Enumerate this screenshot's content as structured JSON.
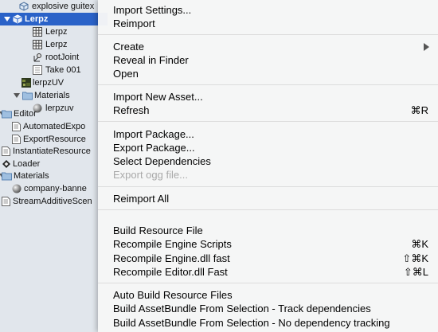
{
  "tree": {
    "items": [
      {
        "label": "explosive guitex",
        "icon": "package-icon"
      },
      {
        "label": "Lerpz",
        "icon": "package-icon"
      },
      {
        "label": "Lerpz",
        "icon": "grid-mesh-icon"
      },
      {
        "label": "Lerpz",
        "icon": "grid-mesh-icon"
      },
      {
        "label": "rootJoint",
        "icon": "transform-icon"
      },
      {
        "label": "Take 001",
        "icon": "animation-clip-icon"
      },
      {
        "label": "lerpzUV",
        "icon": "texture-thumbnail-icon"
      },
      {
        "label": "Materials",
        "icon": "folder-icon"
      },
      {
        "label": "lerpzuv",
        "icon": "material-sphere-icon"
      },
      {
        "label": "Editor",
        "icon": "folder-icon"
      },
      {
        "label": "AutomatedExpo",
        "icon": "script-icon"
      },
      {
        "label": "ExportResource",
        "icon": "script-icon"
      },
      {
        "label": "InstantiateResource",
        "icon": "script-icon"
      },
      {
        "label": "Loader",
        "icon": "unity-scene-icon"
      },
      {
        "label": "Materials",
        "icon": "folder-icon"
      },
      {
        "label": "company-banne",
        "icon": "material-sphere-icon"
      },
      {
        "label": "StreamAdditiveScen",
        "icon": "script-icon"
      }
    ]
  },
  "menu": {
    "items": [
      {
        "label": "Import Settings...",
        "shortcut": ""
      },
      {
        "label": "Reimport",
        "shortcut": ""
      },
      {
        "label": "Create",
        "shortcut": "",
        "submenu_icon": "submenu-arrow-icon"
      },
      {
        "label": "Reveal in Finder",
        "shortcut": ""
      },
      {
        "label": "Open",
        "shortcut": ""
      },
      {
        "label": "Import New Asset...",
        "shortcut": ""
      },
      {
        "label": "Refresh",
        "shortcut": "⌘R"
      },
      {
        "label": "Import Package...",
        "shortcut": ""
      },
      {
        "label": "Export Package...",
        "shortcut": ""
      },
      {
        "label": "Select Dependencies",
        "shortcut": ""
      },
      {
        "label": "Export ogg file...",
        "shortcut": "",
        "disabled": true
      },
      {
        "label": "Reimport All",
        "shortcut": ""
      },
      {
        "label": "Build Resource File",
        "shortcut": ""
      },
      {
        "label": "Recompile Engine Scripts",
        "shortcut": "⌘K"
      },
      {
        "label": "Recompile Engine.dll fast",
        "shortcut": "⇧⌘K"
      },
      {
        "label": "Recompile Editor.dll Fast",
        "shortcut": "⇧⌘L"
      },
      {
        "label": "Auto Build Resource Files",
        "shortcut": ""
      },
      {
        "label": "Build AssetBundle From Selection - Track dependencies",
        "shortcut": ""
      },
      {
        "label": "Build AssetBundle From Selection - No dependency tracking",
        "shortcut": ""
      }
    ]
  },
  "colors": {
    "selection": "#2a62c8",
    "menu_bg": "#f6f6f6",
    "disabled_text": "#a9a9a9",
    "tree_bg": "#e1e6ec"
  }
}
